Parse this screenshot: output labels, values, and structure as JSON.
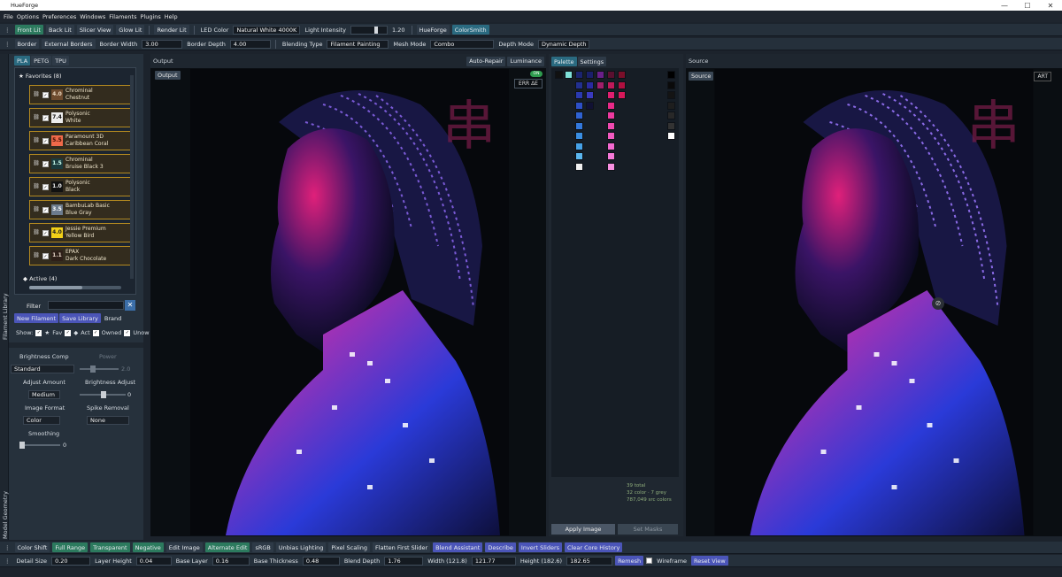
{
  "app": {
    "title": "HueForge"
  },
  "menu": [
    "File",
    "Options",
    "Preferences",
    "Windows",
    "Filaments",
    "Plugins",
    "Help"
  ],
  "toolbar1": {
    "front_lit": "Front Lit",
    "back_lit": "Back Lit",
    "slicer_view": "Slicer View",
    "glow_lit": "Glow Lit",
    "render_lit": "Render Lit",
    "led_color_label": "LED Color",
    "led_color_value": "Natural White 4000K",
    "light_intensity_label": "Light Intensity",
    "light_intensity_value": "1.20",
    "hueforge": "HueForge",
    "colorsmith": "ColorSmith"
  },
  "toolbar2": {
    "border": "Border",
    "external_borders": "External Borders",
    "border_width_label": "Border Width",
    "border_width_value": "3.00",
    "border_depth_label": "Border Depth",
    "border_depth_value": "4.00",
    "blending_type_label": "Blending Type",
    "blending_type_value": "Filament Painting",
    "mesh_mode_label": "Mesh Mode",
    "mesh_mode_value": "Combo",
    "depth_mode_label": "Depth Mode",
    "depth_mode_value": "Dynamic Depth"
  },
  "left": {
    "tabs": [
      "PLA",
      "PETG",
      "TPU"
    ],
    "favorites_label": "Favorites (8)",
    "filaments": [
      {
        "td": "4.0",
        "name1": "Chrominal",
        "name2": "Chestnut",
        "color": "#6e4b2e",
        "text": "#e9d7bf"
      },
      {
        "td": "7.4",
        "name1": "Polysonic",
        "name2": "White",
        "color": "#ededed",
        "text": "#111111"
      },
      {
        "td": "5.5",
        "name1": "Paramount 3D",
        "name2": "Caribbean Coral",
        "color": "#f06a4a",
        "text": "#3b0c00"
      },
      {
        "td": "1.5",
        "name1": "Chrominal",
        "name2": "Bruise Black 3",
        "color": "#1b3b3d",
        "text": "#cfe"
      },
      {
        "td": "1.0",
        "name1": "Polysonic",
        "name2": "Black",
        "color": "#111111",
        "text": "#eeeeee"
      },
      {
        "td": "3.5",
        "name1": "BambuLab Basic",
        "name2": "Blue Gray",
        "color": "#6c7b8e",
        "text": "#ffffff"
      },
      {
        "td": "4.0",
        "name1": "Jessie Premium",
        "name2": "Yellow Bird",
        "color": "#f2d018",
        "text": "#222222"
      },
      {
        "td": "1.1",
        "name1": "EPAX",
        "name2": "Dark Chocolate",
        "color": "#2e1f18",
        "text": "#e6d6c6"
      }
    ],
    "active_label": "Active (4)",
    "filter_label": "Filter",
    "new_filament": "New Filament",
    "save_library": "Save Library",
    "brand": "Brand",
    "show_label": "Show:",
    "show_opts": [
      "Fav",
      "Act",
      "Owned",
      "Unow"
    ],
    "side_label_top": "Filament Library",
    "side_label_bottom": "Model Geometry",
    "brightness_comp": "Brightness Comp",
    "power": "Power",
    "standard": "Standard",
    "power_value": "2.0",
    "adjust_amount": "Adjust Amount",
    "brightness_adjust": "Brightness Adjust",
    "medium": "Medium",
    "brightness_adjust_value": "0",
    "image_format": "Image Format",
    "spike_removal": "Spike Removal",
    "color": "Color",
    "none": "None",
    "smoothing": "Smoothing",
    "smoothing_value": "0"
  },
  "output": {
    "header": "Output",
    "auto_repair": "Auto-Repair",
    "luminance": "Luminance",
    "badge": "Output",
    "err": "ERR ΔE",
    "toggle": "ON"
  },
  "palette": {
    "tab_palette": "Palette",
    "tab_settings": "Settings",
    "stats1": "39 total",
    "stats2": "32 color · 7 grey",
    "stats3": "787,049 src colors",
    "apply": "Apply Image",
    "set_masks": "Set Masks"
  },
  "source": {
    "header": "Source",
    "badge": "Source",
    "art": "ART"
  },
  "bottom1": [
    "Color Shift",
    "Full Range",
    "Transparent",
    "Negative",
    "Edit Image",
    "Alternate Edit",
    "sRGB",
    "Unbias Lighting",
    "Pixel Scaling",
    "Flatten First Slider",
    "Blend Assistant",
    "Describe",
    "Invert Sliders",
    "Clear Core History"
  ],
  "bottom2": {
    "detail_size_label": "Detail Size",
    "detail_size": "0.20",
    "layer_height_label": "Layer Height",
    "layer_height": "0.04",
    "base_layer_label": "Base Layer",
    "base_layer": "0.16",
    "base_thickness_label": "Base Thickness",
    "base_thickness": "0.48",
    "blend_depth_label": "Blend Depth",
    "blend_depth": "1.76",
    "width_label": "Width (121.8)",
    "width": "121.77",
    "height_label": "Height (182.6)",
    "height": "182.65",
    "remesh": "Remesh",
    "wireframe": "Wireframe",
    "reset_view": "Reset View"
  },
  "colors": {
    "accent": "#2c7a5e",
    "blue": "#4b55b8",
    "magenta": "#e0208a"
  }
}
